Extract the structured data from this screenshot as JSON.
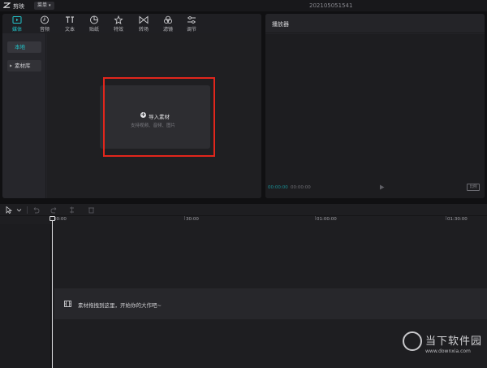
{
  "titlebar": {
    "app_name": "剪映",
    "menu_label": "菜单",
    "project_title": "202105051541"
  },
  "tabs": [
    {
      "label": "媒体",
      "icon": "media-icon",
      "active": true
    },
    {
      "label": "音频",
      "icon": "audio-icon"
    },
    {
      "label": "文本",
      "icon": "text-icon"
    },
    {
      "label": "贴纸",
      "icon": "sticker-icon"
    },
    {
      "label": "特效",
      "icon": "effects-icon"
    },
    {
      "label": "转场",
      "icon": "transition-icon"
    },
    {
      "label": "滤镜",
      "icon": "filter-icon"
    },
    {
      "label": "调节",
      "icon": "adjust-icon"
    }
  ],
  "sidebar": {
    "items": [
      {
        "label": "本地",
        "active": true
      },
      {
        "label": "素材库"
      }
    ]
  },
  "import": {
    "label": "导入素材",
    "hint": "支持视频、音频、图片"
  },
  "player": {
    "title": "播放器",
    "current_time": "00:00:00",
    "total_time": "00:00:00",
    "ratio_label": "比例"
  },
  "timeline": {
    "ruler": [
      "00:00",
      "30:00",
      "01:00:00",
      "01:30:00"
    ],
    "drop_text": "素材拖拽到这里，开始你的大作吧~"
  },
  "watermark": {
    "brand": "当下软件园",
    "url": "www.downxia.com"
  },
  "colors": {
    "accent": "#22c3c9",
    "highlight": "#e2261c",
    "background": "#101012"
  }
}
